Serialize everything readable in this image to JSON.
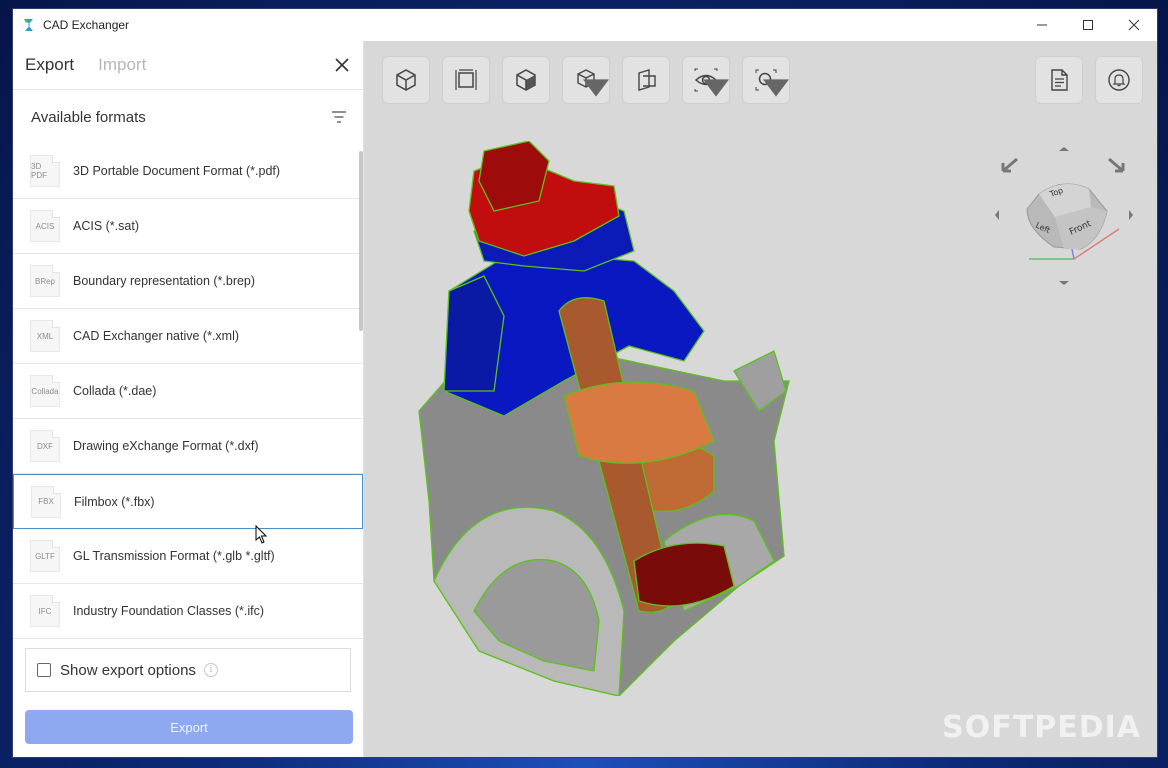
{
  "window": {
    "title": "CAD Exchanger"
  },
  "sidebar": {
    "tabs": [
      {
        "label": "Export",
        "active": true
      },
      {
        "label": "Import",
        "active": false
      }
    ],
    "formats_title": "Available formats",
    "formats": [
      {
        "icon_text": "3D PDF",
        "label": "3D Portable Document Format (*.pdf)"
      },
      {
        "icon_text": "ACIS",
        "label": "ACIS (*.sat)"
      },
      {
        "icon_text": "BRep",
        "label": "Boundary representation (*.brep)"
      },
      {
        "icon_text": "XML",
        "label": "CAD Exchanger native (*.xml)"
      },
      {
        "icon_text": "Collada",
        "label": "Collada (*.dae)"
      },
      {
        "icon_text": "DXF",
        "label": "Drawing eXchange Format (*.dxf)"
      },
      {
        "icon_text": "FBX",
        "label": "Filmbox (*.fbx)",
        "hovered": true
      },
      {
        "icon_text": "GLTF",
        "label": "GL Transmission Format (*.glb *.gltf)"
      },
      {
        "icon_text": "IFC",
        "label": "Industry Foundation Classes (*.ifc)"
      }
    ],
    "show_options_label": "Show export options",
    "export_button": "Export"
  },
  "viewport": {
    "watermark": "SOFTPEDIA",
    "navcube": {
      "top": "Top",
      "front": "Front",
      "left": "Left"
    }
  },
  "colors": {
    "accent": "#8ea9f0",
    "hover_border": "#4a90c8",
    "viewport_bg": "#d8d8d8"
  }
}
